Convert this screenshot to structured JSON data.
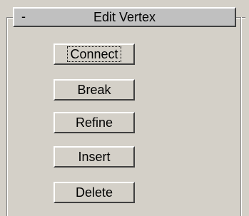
{
  "rollout": {
    "collapse_symbol": "-",
    "title": "Edit Vertex"
  },
  "buttons": {
    "connect": "Connect",
    "break": "Break",
    "refine": "Refine",
    "insert": "Insert",
    "delete": "Delete"
  },
  "focused_button": "connect",
  "colors": {
    "panel_bg": "#d4d0c8",
    "header_bg": "#c0c0c0"
  }
}
